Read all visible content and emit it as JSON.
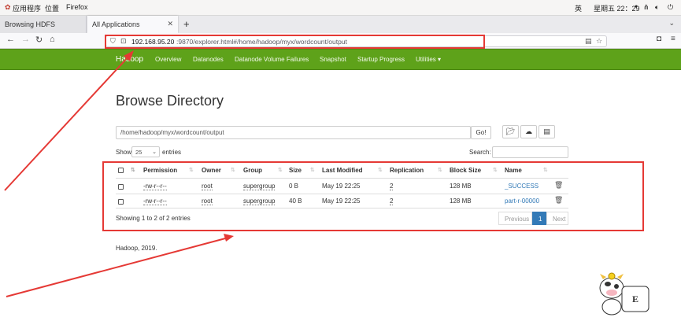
{
  "system_bar": {
    "apps": "应用程序",
    "places": "位置",
    "app_name": "Firefox",
    "input_method": "英",
    "clock": "星期五 22：29",
    "status_dot": "●"
  },
  "browser": {
    "tabs": [
      {
        "label": "Browsing HDFS",
        "active": false
      },
      {
        "label": "All Applications",
        "active": true
      }
    ],
    "tab_close": "✕",
    "new_tab": "+",
    "url_host": "192.168.95.20",
    "url_path": ":9870/explorer.html#/home/hadoop/myx/wordcount/output"
  },
  "hadoop_nav": {
    "brand": "Hadoop",
    "items": [
      "Overview",
      "Datanodes",
      "Datanode Volume Failures",
      "Snapshot",
      "Startup Progress",
      "Utilities ▾"
    ]
  },
  "page": {
    "title": "Browse Directory",
    "directory": "/home/hadoop/myx/wordcount/output",
    "go_label": "Go!",
    "show_label": "Show",
    "entries_value": "25",
    "entries_label": "entries",
    "search_label": "Search:"
  },
  "table": {
    "columns": [
      "Permission",
      "Owner",
      "Group",
      "Size",
      "Last Modified",
      "Replication",
      "Block Size",
      "Name"
    ],
    "rows": [
      {
        "permission": "-rw-r--r--",
        "owner": "root",
        "group": "supergroup",
        "size": "0 B",
        "last_modified": "May 19 22:25",
        "replication": "2",
        "block_size": "128 MB",
        "name": "_SUCCESS"
      },
      {
        "permission": "-rw-r--r--",
        "owner": "root",
        "group": "supergroup",
        "size": "40 B",
        "last_modified": "May 19 22:25",
        "replication": "2",
        "block_size": "128 MB",
        "name": "part-r-00000"
      }
    ],
    "info": "Showing 1 to 2 of 2 entries",
    "pagination": {
      "previous": "Previous",
      "current": "1",
      "next": "Next"
    }
  },
  "footer": "Hadoop, 2019.",
  "colors": {
    "hadoop_green": "#5ea21a",
    "link": "#337ab7",
    "annotation_red": "#e53935"
  }
}
